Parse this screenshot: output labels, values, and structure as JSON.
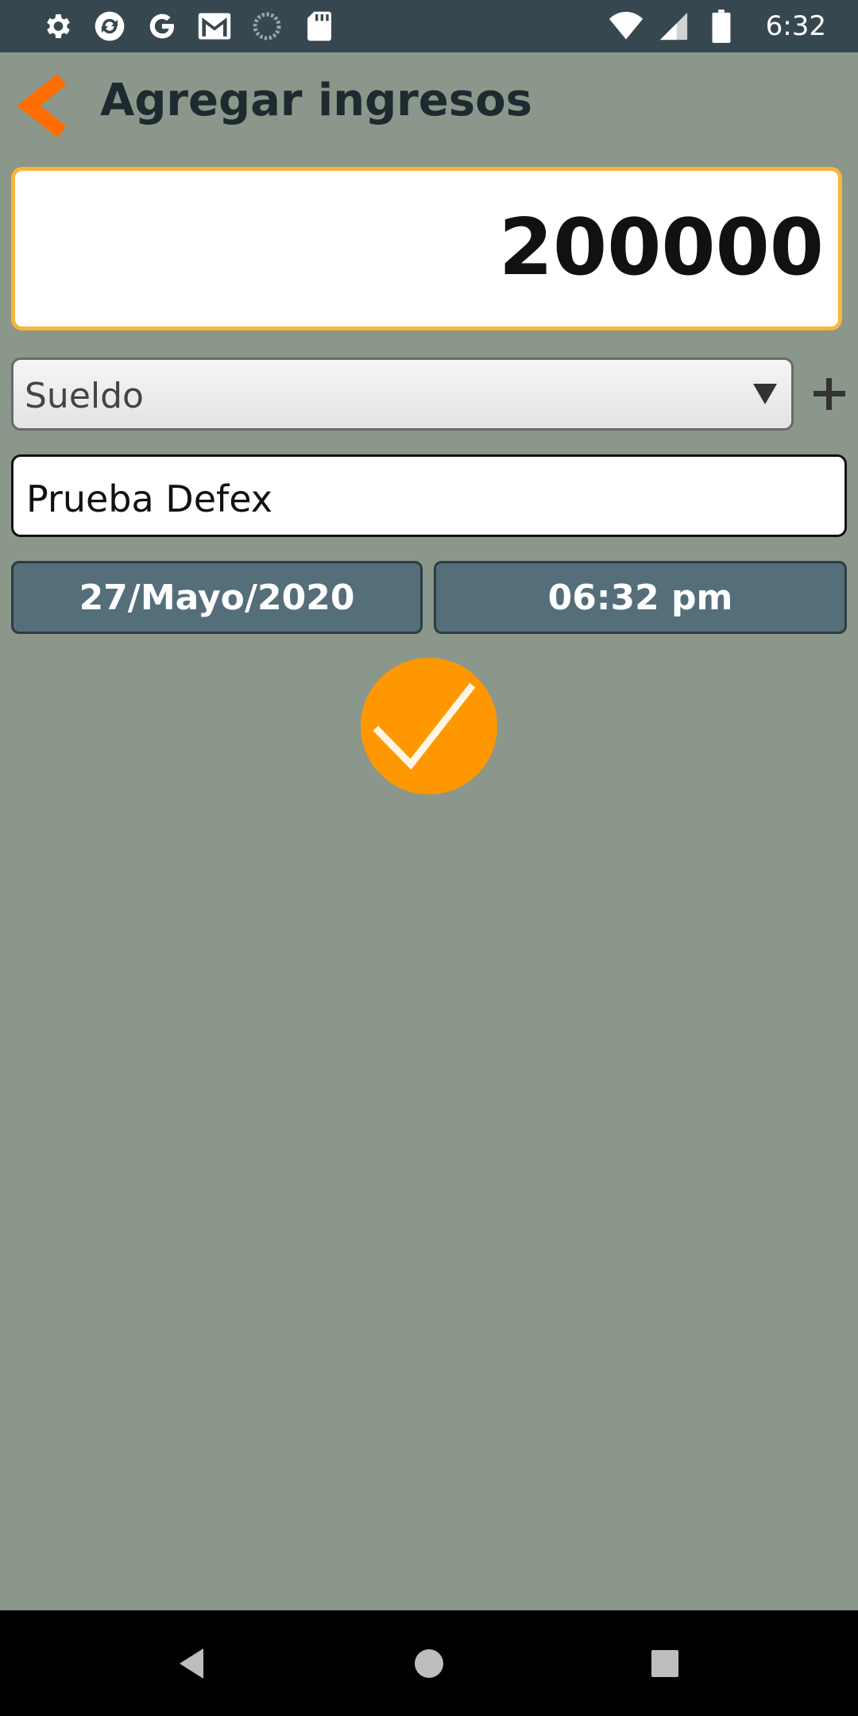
{
  "status_bar": {
    "time": "6:32",
    "left_icons": [
      "settings-icon",
      "sync-app-icon",
      "google-icon",
      "gmail-icon",
      "loading-circle-icon",
      "sd-card-icon"
    ],
    "right_icons": [
      "wifi-icon",
      "cell-signal-icon",
      "battery-icon"
    ]
  },
  "header": {
    "title": "Agregar ingresos"
  },
  "form": {
    "amount": "200000",
    "category": "Sueldo",
    "description": "Prueba Defex",
    "date": "27/Mayo/2020",
    "time": "06:32 pm"
  },
  "colors": {
    "background": "#8a978a",
    "status_bar": "#37474f",
    "accent": "#ff9800",
    "amount_border": "#f7b63a",
    "button": "#546e7a",
    "back_arrow": "#ff6d00"
  }
}
